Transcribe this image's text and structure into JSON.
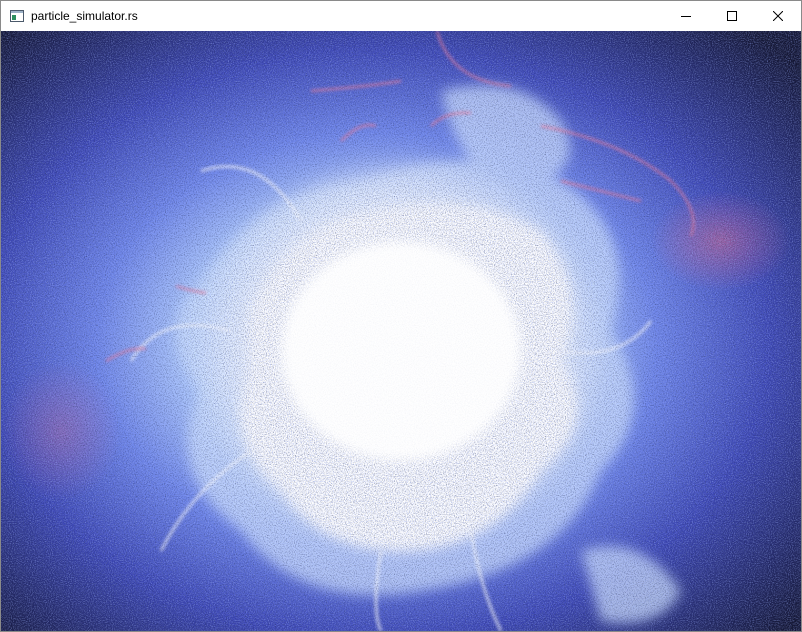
{
  "window": {
    "title": "particle_simulator.rs",
    "icon": "window-app-icon",
    "controls": {
      "minimize_icon": "minimize-icon",
      "maximize_icon": "maximize-icon",
      "close_icon": "close-icon"
    }
  },
  "canvas": {
    "scene": "particle-burst",
    "colors": {
      "background": "#1b1f45",
      "core": "#ffffff",
      "glow": "#b9d4ff",
      "halo": "#5b6ee0",
      "filament": "#e87a9a"
    }
  }
}
